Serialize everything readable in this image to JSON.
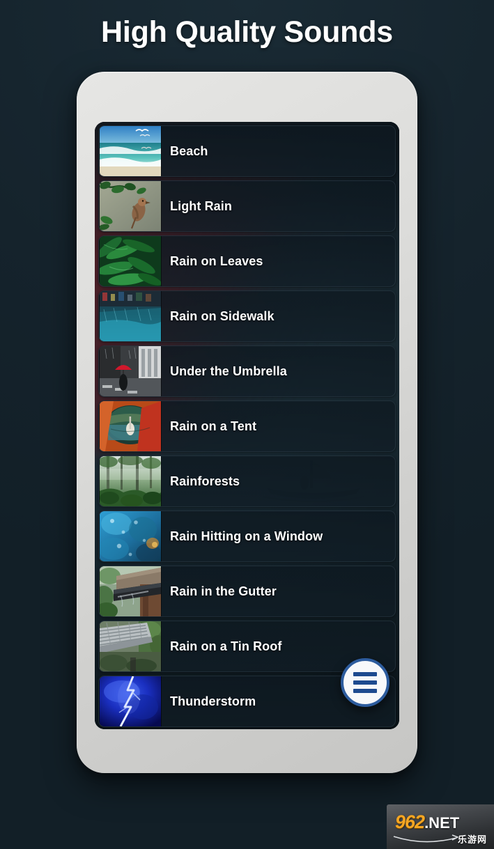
{
  "headline": "High Quality Sounds",
  "screen": {
    "fab": {
      "icon": "hamburger-menu-icon",
      "accent_color": "#2d5c9e",
      "background_color": "#f7f8fa"
    },
    "sounds": [
      {
        "label": "Beach",
        "thumb": "beach-thumbnail"
      },
      {
        "label": "Light Rain",
        "thumb": "light-rain-bird-thumbnail"
      },
      {
        "label": "Rain on Leaves",
        "thumb": "rain-on-leaves-thumbnail"
      },
      {
        "label": "Rain on Sidewalk",
        "thumb": "rain-on-sidewalk-thumbnail"
      },
      {
        "label": "Under the Umbrella",
        "thumb": "under-the-umbrella-thumbnail"
      },
      {
        "label": "Rain on a Tent",
        "thumb": "rain-on-a-tent-thumbnail"
      },
      {
        "label": "Rainforests",
        "thumb": "rainforests-thumbnail"
      },
      {
        "label": "Rain Hitting on a Window",
        "thumb": "rain-hitting-on-a-window-thumbnail"
      },
      {
        "label": "Rain in the Gutter",
        "thumb": "rain-in-the-gutter-thumbnail"
      },
      {
        "label": "Rain on a Tin Roof",
        "thumb": "rain-on-a-tin-roof-thumbnail"
      },
      {
        "label": "Thunderstorm",
        "thumb": "thunderstorm-thumbnail"
      }
    ]
  },
  "watermark": {
    "number": "962",
    "tld": ".NET",
    "chinese": "乐游网"
  },
  "colors": {
    "page_background": "#16242d",
    "headline": "#ffffff",
    "phone_frame": "#dcdcda",
    "row_background": "#101d25",
    "row_text": "#ffffff",
    "fab_ring": "#2d5c9e",
    "fab_bars": "#1d4a8f",
    "wallpaper_maroon": "#601e26",
    "wallpaper_teal": "#1b2d36"
  }
}
